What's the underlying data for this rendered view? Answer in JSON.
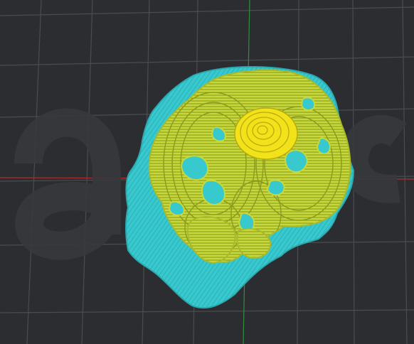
{
  "viewport": {
    "background_color": "#2b2d30",
    "grid_line_color": "#4a4c50",
    "x_axis_color": "#b03030",
    "y_axis_color": "#2f8f3f",
    "watermark_color": "#3a3c40"
  },
  "model": {
    "raft_color": "#38c9cf",
    "raft_hatch_color": "#2aa9b0",
    "wall_color": "#c6d83a",
    "wall_line_color": "#7a8a1a",
    "top_color": "#f2e21a"
  }
}
